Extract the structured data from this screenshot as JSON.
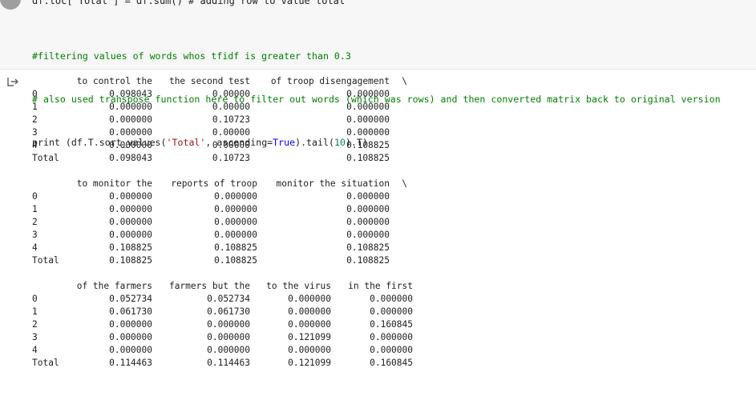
{
  "code_cell": {
    "cut_line": "df.loc['Total'] = df.sum() # adding row to value total",
    "lines": [
      "#filtering values of words whos tfidf is greater than 0.3",
      "# also used transpose function here to filter out words (which was rows) and then converted matrix back to original version",
      "print (df.T.sort_values('Total', ascending=True).tail(10).T)"
    ]
  },
  "output": {
    "row_index": [
      "0",
      "1",
      "2",
      "3",
      "4",
      "Total"
    ],
    "blocks": [
      {
        "headers": [
          "to control the",
          "the second test",
          "of troop disengagement",
          "\\"
        ],
        "rows": [
          [
            "0.098043",
            "0.00000",
            "0.000000"
          ],
          [
            "0.000000",
            "0.00000",
            "0.000000"
          ],
          [
            "0.000000",
            "0.10723",
            "0.000000"
          ],
          [
            "0.000000",
            "0.00000",
            "0.000000"
          ],
          [
            "0.000000",
            "0.00000",
            "0.108825"
          ],
          [
            "0.098043",
            "0.10723",
            "0.108825"
          ]
        ]
      },
      {
        "headers": [
          "to monitor the",
          "reports of troop",
          "monitor the situation",
          "\\"
        ],
        "rows": [
          [
            "0.000000",
            "0.000000",
            "0.000000"
          ],
          [
            "0.000000",
            "0.000000",
            "0.000000"
          ],
          [
            "0.000000",
            "0.000000",
            "0.000000"
          ],
          [
            "0.000000",
            "0.000000",
            "0.000000"
          ],
          [
            "0.108825",
            "0.108825",
            "0.108825"
          ],
          [
            "0.108825",
            "0.108825",
            "0.108825"
          ]
        ]
      },
      {
        "headers": [
          "of the farmers",
          "farmers but the",
          "to the virus",
          "in the first"
        ],
        "rows": [
          [
            "0.052734",
            "0.052734",
            "0.000000",
            "0.000000"
          ],
          [
            "0.061730",
            "0.061730",
            "0.000000",
            "0.000000"
          ],
          [
            "0.000000",
            "0.000000",
            "0.000000",
            "0.160845"
          ],
          [
            "0.000000",
            "0.000000",
            "0.121099",
            "0.000000"
          ],
          [
            "0.000000",
            "0.000000",
            "0.000000",
            "0.000000"
          ],
          [
            "0.114463",
            "0.114463",
            "0.121099",
            "0.160845"
          ]
        ]
      }
    ]
  },
  "colors": {
    "comment": "#008000",
    "number": "#098658",
    "string": "#a31515",
    "keyword": "#0000ff"
  }
}
